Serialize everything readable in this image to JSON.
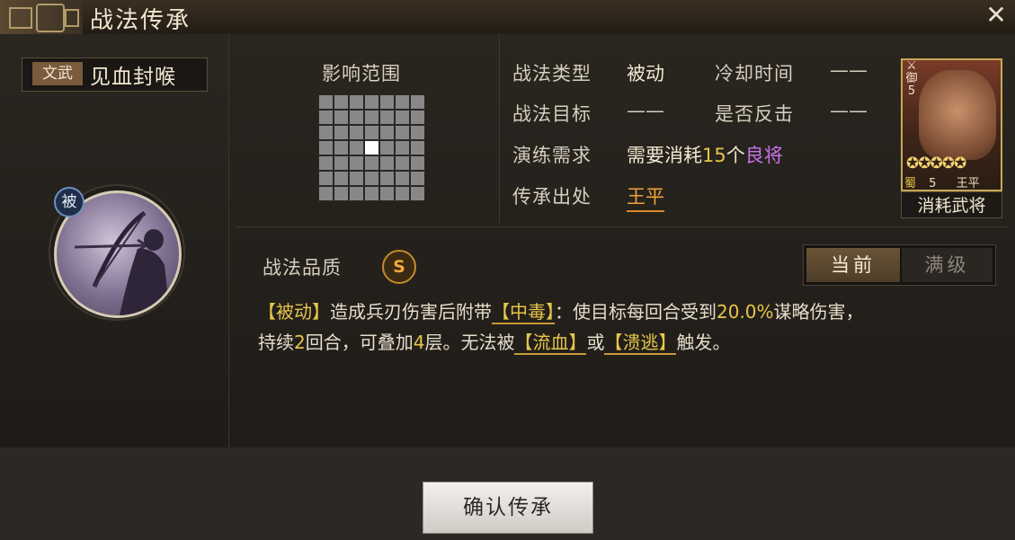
{
  "window": {
    "title": "战法传承",
    "close_symbol": "✕"
  },
  "skill": {
    "tag": "文武",
    "name": "见血封喉",
    "type_badge": "被"
  },
  "range": {
    "label": "影响范围",
    "grid_size": 7,
    "highlight_cell": [
      3,
      3
    ]
  },
  "info": {
    "type_label": "战法类型",
    "type_value": "被动",
    "cooldown_label": "冷却时间",
    "cooldown_value": "——",
    "target_label": "战法目标",
    "target_value": "——",
    "counter_label": "是否反击",
    "counter_value": "——",
    "train_label": "演练需求",
    "train_prefix": "需要消耗",
    "train_count": "15",
    "train_unit": "个",
    "train_item": "良将",
    "source_label": "传承出处",
    "source_value": "王平"
  },
  "hero_card": {
    "cost_label": "御",
    "cost": "5",
    "stars": "✪✪✪✪✪",
    "faction": "蜀",
    "level": "5",
    "name": "王平",
    "caption": "消耗武将"
  },
  "quality": {
    "label": "战法品质",
    "grade": "S"
  },
  "toggle": {
    "current": "当前",
    "max": "满级"
  },
  "description": {
    "p1": "【被动】",
    "p2": "造成兵刃伤害后附带",
    "p3": "【中毒】",
    "p4": "：使目标每回合受到",
    "p5": "20.0%",
    "p6": "谋略伤害，",
    "p7": "持续",
    "p8": "2",
    "p9": "回合，可叠加",
    "p10": "4",
    "p11": "层。无法被",
    "p12": "【流血】",
    "p13": "或",
    "p14": "【溃逃】",
    "p15": "触发。"
  },
  "confirm_button": "确认传承",
  "colors": {
    "accent_orange": "#f0a23a",
    "accent_yellow": "#e8c54a",
    "accent_purple": "#c873e8"
  }
}
